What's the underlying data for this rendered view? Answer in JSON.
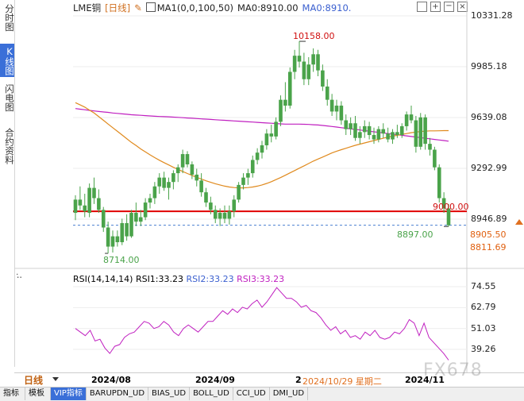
{
  "side_tabs": [
    {
      "label": "分时图",
      "active": false
    },
    {
      "label": "K线图",
      "active": true
    },
    {
      "label": "闪电图",
      "active": false
    },
    {
      "label": "合约资料",
      "active": false
    }
  ],
  "legend": {
    "symbol": "LME铜",
    "period": "[日线]",
    "ma_config": "MA1(0,0,100,50)",
    "ma0": "MA0:8910.00",
    "ma1": "MA0:8910."
  },
  "toolbar_icons": [
    "expand-icon",
    "zoom-in-icon",
    "zoom-out-icon",
    "close-icon"
  ],
  "price_axis": [
    "10331.28",
    "9985.18",
    "9639.08",
    "9292.99",
    "8946.89"
  ],
  "rsi_axis": [
    "74.55",
    "62.79",
    "51.03",
    "39.26"
  ],
  "rsi_legend": {
    "params": "RSI(14,14,14)",
    "rsi1": "RSI1:33.23",
    "rsi2": "RSI2:33.23",
    "rsi3": "RSI3:33.23"
  },
  "annotations": {
    "high": "10158.00",
    "low": "8714.00",
    "last_low": "8897.00",
    "hline_value": "9000.00"
  },
  "price_boxes": [
    "8905.50",
    "8811.69"
  ],
  "x_axis": {
    "period_label": "日线",
    "dates": [
      "2024/08",
      "2024/09",
      "2",
      "2024/11"
    ],
    "crosshair_date": "2024/10/29 星期二"
  },
  "watermark": "FX678",
  "bottom_tabs": [
    {
      "label": "指标",
      "active": false
    },
    {
      "label": "模板",
      "active": false
    },
    {
      "label": "VIP指标",
      "active": true
    },
    {
      "label": "BARUPDN_UD",
      "active": false
    },
    {
      "label": "BIAS_UD",
      "active": false
    },
    {
      "label": "BOLL_UD",
      "active": false
    },
    {
      "label": "CCI_UD",
      "active": false
    },
    {
      "label": "DMI_UD",
      "active": false
    }
  ],
  "colors": {
    "up": "#4aa34a",
    "down": "#4aa34a",
    "ma_orange": "#e08a1e",
    "ma_magenta": "#c020c0",
    "hline": "#e00000",
    "rsi": "#c020c0",
    "accent": "#3a6fd8",
    "annotation": "#d01010",
    "low_label": "#4aa34a"
  },
  "chart_data": {
    "type": "candlestick",
    "ylim": [
      8650,
      10400
    ],
    "candles": [
      {
        "o": 8990,
        "h": 9110,
        "l": 8940,
        "c": 9080
      },
      {
        "o": 9080,
        "h": 9170,
        "l": 9010,
        "c": 9040
      },
      {
        "o": 9040,
        "h": 9120,
        "l": 8960,
        "c": 9000
      },
      {
        "o": 8990,
        "h": 9190,
        "l": 8960,
        "c": 9160
      },
      {
        "o": 9160,
        "h": 9230,
        "l": 9050,
        "c": 9090
      },
      {
        "o": 9090,
        "h": 9150,
        "l": 8990,
        "c": 9010
      },
      {
        "o": 9010,
        "h": 9030,
        "l": 8860,
        "c": 8890
      },
      {
        "o": 8890,
        "h": 8930,
        "l": 8714,
        "c": 8760
      },
      {
        "o": 8760,
        "h": 8870,
        "l": 8720,
        "c": 8830
      },
      {
        "o": 8830,
        "h": 8870,
        "l": 8760,
        "c": 8790
      },
      {
        "o": 8790,
        "h": 8950,
        "l": 8770,
        "c": 8920
      },
      {
        "o": 8920,
        "h": 8980,
        "l": 8800,
        "c": 8830
      },
      {
        "o": 8830,
        "h": 9010,
        "l": 8820,
        "c": 8990
      },
      {
        "o": 8990,
        "h": 9060,
        "l": 8900,
        "c": 8930
      },
      {
        "o": 8930,
        "h": 9010,
        "l": 8900,
        "c": 8960
      },
      {
        "o": 8960,
        "h": 9090,
        "l": 8940,
        "c": 9060
      },
      {
        "o": 9060,
        "h": 9120,
        "l": 9020,
        "c": 9090
      },
      {
        "o": 9090,
        "h": 9200,
        "l": 9050,
        "c": 9170
      },
      {
        "o": 9170,
        "h": 9260,
        "l": 9120,
        "c": 9230
      },
      {
        "o": 9230,
        "h": 9270,
        "l": 9140,
        "c": 9160
      },
      {
        "o": 9160,
        "h": 9230,
        "l": 9080,
        "c": 9200
      },
      {
        "o": 9200,
        "h": 9280,
        "l": 9150,
        "c": 9260
      },
      {
        "o": 9260,
        "h": 9320,
        "l": 9200,
        "c": 9300
      },
      {
        "o": 9300,
        "h": 9420,
        "l": 9260,
        "c": 9390
      },
      {
        "o": 9390,
        "h": 9410,
        "l": 9300,
        "c": 9320
      },
      {
        "o": 9320,
        "h": 9340,
        "l": 9220,
        "c": 9250
      },
      {
        "o": 9250,
        "h": 9290,
        "l": 9170,
        "c": 9210
      },
      {
        "o": 9210,
        "h": 9260,
        "l": 9100,
        "c": 9130
      },
      {
        "o": 9130,
        "h": 9160,
        "l": 9030,
        "c": 9060
      },
      {
        "o": 9060,
        "h": 9100,
        "l": 8980,
        "c": 9010
      },
      {
        "o": 9010,
        "h": 9040,
        "l": 8920,
        "c": 8950
      },
      {
        "o": 8950,
        "h": 9020,
        "l": 8900,
        "c": 8990
      },
      {
        "o": 8990,
        "h": 9040,
        "l": 8920,
        "c": 8950
      },
      {
        "o": 8950,
        "h": 9040,
        "l": 8910,
        "c": 9000
      },
      {
        "o": 9000,
        "h": 9110,
        "l": 8960,
        "c": 9080
      },
      {
        "o": 9080,
        "h": 9200,
        "l": 9060,
        "c": 9180
      },
      {
        "o": 9180,
        "h": 9260,
        "l": 9150,
        "c": 9230
      },
      {
        "o": 9230,
        "h": 9290,
        "l": 9180,
        "c": 9260
      },
      {
        "o": 9260,
        "h": 9380,
        "l": 9230,
        "c": 9350
      },
      {
        "o": 9350,
        "h": 9430,
        "l": 9320,
        "c": 9400
      },
      {
        "o": 9400,
        "h": 9480,
        "l": 9360,
        "c": 9450
      },
      {
        "o": 9450,
        "h": 9560,
        "l": 9420,
        "c": 9530
      },
      {
        "o": 9530,
        "h": 9590,
        "l": 9470,
        "c": 9510
      },
      {
        "o": 9510,
        "h": 9640,
        "l": 9490,
        "c": 9610
      },
      {
        "o": 9610,
        "h": 9790,
        "l": 9580,
        "c": 9760
      },
      {
        "o": 9760,
        "h": 9880,
        "l": 9680,
        "c": 9720
      },
      {
        "o": 9720,
        "h": 9980,
        "l": 9700,
        "c": 9950
      },
      {
        "o": 9950,
        "h": 10100,
        "l": 9900,
        "c": 10060
      },
      {
        "o": 10060,
        "h": 10158,
        "l": 9980,
        "c": 10020
      },
      {
        "o": 10020,
        "h": 10080,
        "l": 9860,
        "c": 9900
      },
      {
        "o": 9900,
        "h": 10050,
        "l": 9860,
        "c": 10000
      },
      {
        "o": 10000,
        "h": 10110,
        "l": 9950,
        "c": 10070
      },
      {
        "o": 10070,
        "h": 10100,
        "l": 9920,
        "c": 9960
      },
      {
        "o": 9960,
        "h": 10000,
        "l": 9820,
        "c": 9850
      },
      {
        "o": 9850,
        "h": 9900,
        "l": 9720,
        "c": 9760
      },
      {
        "o": 9760,
        "h": 9800,
        "l": 9650,
        "c": 9680
      },
      {
        "o": 9680,
        "h": 9760,
        "l": 9620,
        "c": 9720
      },
      {
        "o": 9720,
        "h": 9750,
        "l": 9590,
        "c": 9620
      },
      {
        "o": 9620,
        "h": 9660,
        "l": 9520,
        "c": 9560
      },
      {
        "o": 9560,
        "h": 9640,
        "l": 9520,
        "c": 9600
      },
      {
        "o": 9600,
        "h": 9650,
        "l": 9480,
        "c": 9500
      },
      {
        "o": 9500,
        "h": 9580,
        "l": 9460,
        "c": 9540
      },
      {
        "o": 9540,
        "h": 9620,
        "l": 9500,
        "c": 9580
      },
      {
        "o": 9580,
        "h": 9610,
        "l": 9490,
        "c": 9520
      },
      {
        "o": 9520,
        "h": 9570,
        "l": 9460,
        "c": 9490
      },
      {
        "o": 9490,
        "h": 9580,
        "l": 9470,
        "c": 9560
      },
      {
        "o": 9560,
        "h": 9600,
        "l": 9500,
        "c": 9530
      },
      {
        "o": 9530,
        "h": 9570,
        "l": 9470,
        "c": 9490
      },
      {
        "o": 9490,
        "h": 9560,
        "l": 9460,
        "c": 9540
      },
      {
        "o": 9540,
        "h": 9590,
        "l": 9500,
        "c": 9520
      },
      {
        "o": 9520,
        "h": 9600,
        "l": 9500,
        "c": 9580
      },
      {
        "o": 9580,
        "h": 9680,
        "l": 9550,
        "c": 9660
      },
      {
        "o": 9660,
        "h": 9720,
        "l": 9600,
        "c": 9620
      },
      {
        "o": 9620,
        "h": 9650,
        "l": 9400,
        "c": 9440
      },
      {
        "o": 9440,
        "h": 9670,
        "l": 9420,
        "c": 9640
      },
      {
        "o": 9640,
        "h": 9660,
        "l": 9420,
        "c": 9460
      },
      {
        "o": 9460,
        "h": 9500,
        "l": 9380,
        "c": 9420
      },
      {
        "o": 9420,
        "h": 9440,
        "l": 9280,
        "c": 9300
      },
      {
        "o": 9300,
        "h": 9320,
        "l": 9060,
        "c": 9090
      },
      {
        "o": 9090,
        "h": 9130,
        "l": 8990,
        "c": 9020
      },
      {
        "o": 9020,
        "h": 9050,
        "l": 8897,
        "c": 8905.5
      }
    ],
    "ma_orange": [
      9740,
      9725,
      9710,
      9690,
      9670,
      9645,
      9620,
      9595,
      9570,
      9545,
      9520,
      9495,
      9470,
      9448,
      9425,
      9405,
      9385,
      9366,
      9348,
      9332,
      9316,
      9300,
      9286,
      9272,
      9258,
      9245,
      9232,
      9220,
      9208,
      9198,
      9188,
      9180,
      9172,
      9166,
      9162,
      9160,
      9160,
      9162,
      9166,
      9172,
      9180,
      9190,
      9202,
      9216,
      9230,
      9246,
      9262,
      9278,
      9294,
      9310,
      9326,
      9342,
      9356,
      9370,
      9384,
      9398,
      9410,
      9420,
      9430,
      9440,
      9450,
      9458,
      9466,
      9474,
      9482,
      9490,
      9498,
      9506,
      9512,
      9518,
      9524,
      9530,
      9536,
      9540,
      9544,
      9546,
      9548,
      9548,
      9549,
      9550,
      9550
    ],
    "ma_magenta": [
      9700,
      9696,
      9692,
      9688,
      9684,
      9680,
      9677,
      9674,
      9670,
      9667,
      9664,
      9661,
      9658,
      9656,
      9654,
      9652,
      9650,
      9648,
      9646,
      9645,
      9644,
      9642,
      9640,
      9638,
      9636,
      9634,
      9632,
      9630,
      9628,
      9626,
      9624,
      9622,
      9620,
      9618,
      9616,
      9614,
      9612,
      9610,
      9608,
      9606,
      9604,
      9602,
      9600,
      9598,
      9596,
      9594,
      9594,
      9594,
      9594,
      9593,
      9592,
      9590,
      9588,
      9585,
      9582,
      9578,
      9574,
      9570,
      9566,
      9562,
      9558,
      9554,
      9550,
      9546,
      9542,
      9538,
      9534,
      9530,
      9526,
      9522,
      9518,
      9514,
      9510,
      9506,
      9502,
      9498,
      9494,
      9490,
      9486,
      9482,
      9478
    ],
    "rsi_ylim": [
      30,
      80
    ],
    "rsi": [
      51,
      49,
      47,
      50,
      44,
      45,
      40,
      37,
      41,
      42,
      46,
      48,
      49,
      52,
      55,
      54,
      51,
      52,
      55,
      53,
      49,
      47,
      51,
      53,
      51,
      49,
      52,
      55,
      55,
      58,
      61,
      59,
      62,
      60,
      63,
      62,
      65,
      67,
      63,
      66,
      70,
      74,
      71,
      68,
      68,
      66,
      63,
      64,
      61,
      60,
      57,
      53,
      50,
      52,
      48,
      50,
      46,
      47,
      45,
      49,
      47,
      50,
      46,
      45,
      46,
      49,
      48,
      51,
      56,
      54,
      47,
      54,
      46,
      43,
      40,
      37,
      33.23
    ]
  }
}
